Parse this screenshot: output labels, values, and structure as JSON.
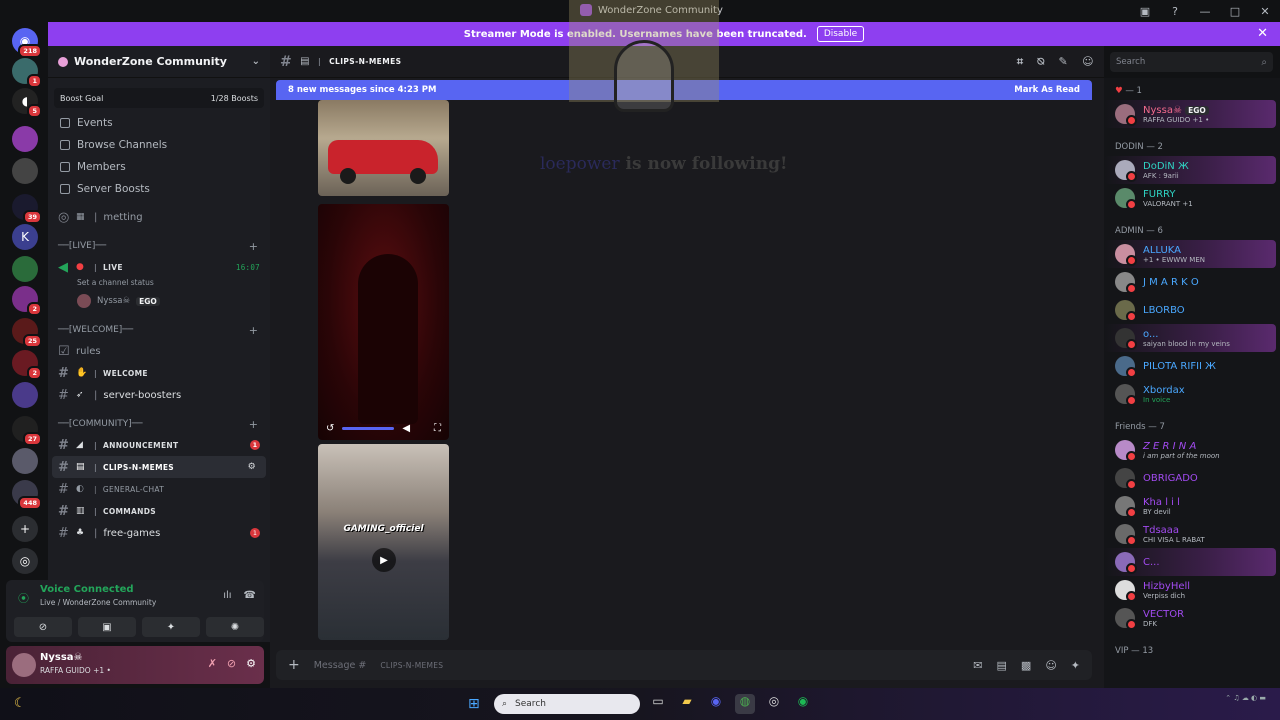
{
  "window": {
    "title": "WonderZone Community"
  },
  "banner": {
    "text": "Streamer Mode is enabled. Usernames have been truncated.",
    "button": "Disable"
  },
  "rail": {
    "badges": [
      "218",
      "1",
      "5",
      "39",
      "2",
      "25",
      "2",
      "27",
      "448"
    ]
  },
  "guild": {
    "name": "WonderZone Community",
    "boost_label": "Boost Goal",
    "boost_value": "1/28 Boosts",
    "nav": [
      "Events",
      "Browse Channels",
      "Members",
      "Server Boosts"
    ],
    "voice_channel": "metting"
  },
  "categories": {
    "live": "──[LIVE]──",
    "welcome": "──[WELCOME]──",
    "community": "──[COMMUNITY]──"
  },
  "live_channel": {
    "name": "LIVE",
    "time": "16:07",
    "status": "Set a channel status"
  },
  "voice_user": {
    "name": "Nyssa☠",
    "tag": "EGO"
  },
  "channels": {
    "rules": "rules",
    "welcome": "WELCOME",
    "server_boosters": "server-boosters",
    "announcement": "ANNOUNCEMENT",
    "announcement_badge": "1",
    "clips": "CLIPS-N-MEMES",
    "general": "GENERAL-CHAT",
    "commands": "COMMANDS",
    "free_games": "free-games",
    "free_games_badge": "1"
  },
  "voicepanel": {
    "title": "Voice Connected",
    "subtitle": "Live / WonderZone Community"
  },
  "user": {
    "name": "Nyssa☠",
    "status": "RAFFA GUIDO +1 •"
  },
  "main": {
    "channel": "CLIPS-N-MEMES",
    "new_messages": "8 new messages since 4:23 PM",
    "mark_read": "Mark As Read",
    "clip3_caption": "GAMING_officiel",
    "composer_placeholder": "Message #",
    "composer_channel": "CLIPS-N-MEMES"
  },
  "overlay": {
    "username": "loepower",
    "text": "is now following!"
  },
  "search": {
    "placeholder": "Search"
  },
  "members": {
    "group0": "— 1",
    "m0": {
      "name": "Nyssa☠",
      "tag": "EGO",
      "status": "RAFFA GUIDO +1 •",
      "color": "#f26a8d"
    },
    "group1": "DODIN — 2",
    "dodin": [
      {
        "name": "DoDiN Ж",
        "status": "AFK : 9arii",
        "color": "#2fd3c3"
      },
      {
        "name": "FURRY",
        "status": "VALORANT +1",
        "color": "#2fd3c3"
      }
    ],
    "group2": "ADMIN — 6",
    "admin": [
      {
        "name": "ALLUKA",
        "status": "+1 • EWWW MEN",
        "color": "#4aa8ff"
      },
      {
        "name": "J M A R K O",
        "status": "",
        "color": "#4aa8ff"
      },
      {
        "name": "LBORBO",
        "status": "",
        "color": "#4aa8ff"
      },
      {
        "name": "o...",
        "status": "saiyan blood in my veins",
        "color": "#4aa8ff"
      },
      {
        "name": "PILOTA RIFII Ж",
        "status": "",
        "color": "#4aa8ff"
      },
      {
        "name": "Xbordax",
        "status": "In voice",
        "color": "#4aa8ff"
      }
    ],
    "group3": "Friends — 7",
    "friends": [
      {
        "name": "Z E R I N A",
        "status": "i am part of the moon",
        "color": "#a24bf0"
      },
      {
        "name": "OBRIGADO",
        "status": "",
        "color": "#a24bf0"
      },
      {
        "name": "Kha l i l",
        "status": "BY devil",
        "color": "#a24bf0"
      },
      {
        "name": "Tdsaaa",
        "status": "CHI VISA L RABAT",
        "color": "#a24bf0"
      },
      {
        "name": "C...",
        "status": "",
        "color": "#a24bf0"
      },
      {
        "name": "HizbyHell",
        "status": "Verpiss dich",
        "color": "#a24bf0"
      },
      {
        "name": "VECTOR",
        "status": "DFK",
        "color": "#a24bf0"
      }
    ],
    "group4": "VIP — 13"
  },
  "taskbar": {
    "search": "Search"
  }
}
